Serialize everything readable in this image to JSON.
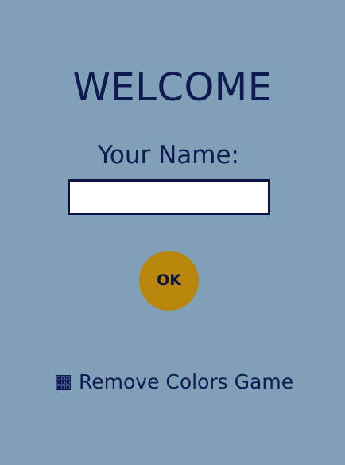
{
  "heading": {
    "title": "WELCOME"
  },
  "form": {
    "name_label": "Your Name:",
    "name_value": "",
    "ok_label": "OK"
  },
  "game": {
    "icon": "grid-icon",
    "label": "Remove Colors Game"
  },
  "colors": {
    "background": "#7fa0b6",
    "text": "#101a52",
    "button": "#b8860b"
  }
}
